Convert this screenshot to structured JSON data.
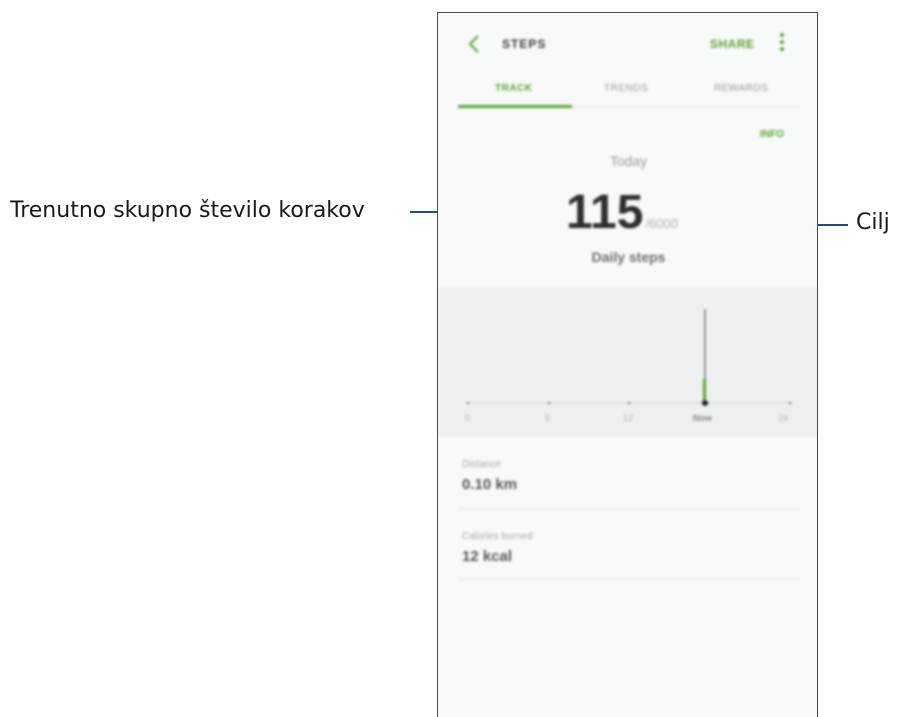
{
  "annotations": {
    "left_label": "Trenutno skupno število korakov",
    "right_label": "Cilj"
  },
  "header": {
    "title": "STEPS",
    "share_label": "SHARE",
    "back_icon": "back-arrow-icon",
    "more_icon": "more-vert-icon"
  },
  "tabs": [
    {
      "label": "TRACK",
      "active": true
    },
    {
      "label": "TRENDS",
      "active": false
    },
    {
      "label": "REWARDS",
      "active": false
    }
  ],
  "info_label": "INFO",
  "summary": {
    "day_label": "Today",
    "steps": "115",
    "goal": "/6000",
    "caption": "Daily steps"
  },
  "chart": {
    "x_labels": [
      "0",
      "6",
      "12",
      "Now",
      "24"
    ],
    "accent": "#5aa531"
  },
  "stats": [
    {
      "label": "Distance",
      "value": "0.10 km"
    },
    {
      "label": "Calories burned",
      "value": "12 kcal"
    }
  ],
  "colors": {
    "accent": "#5aa531",
    "leader_line": "#1b4e86"
  }
}
